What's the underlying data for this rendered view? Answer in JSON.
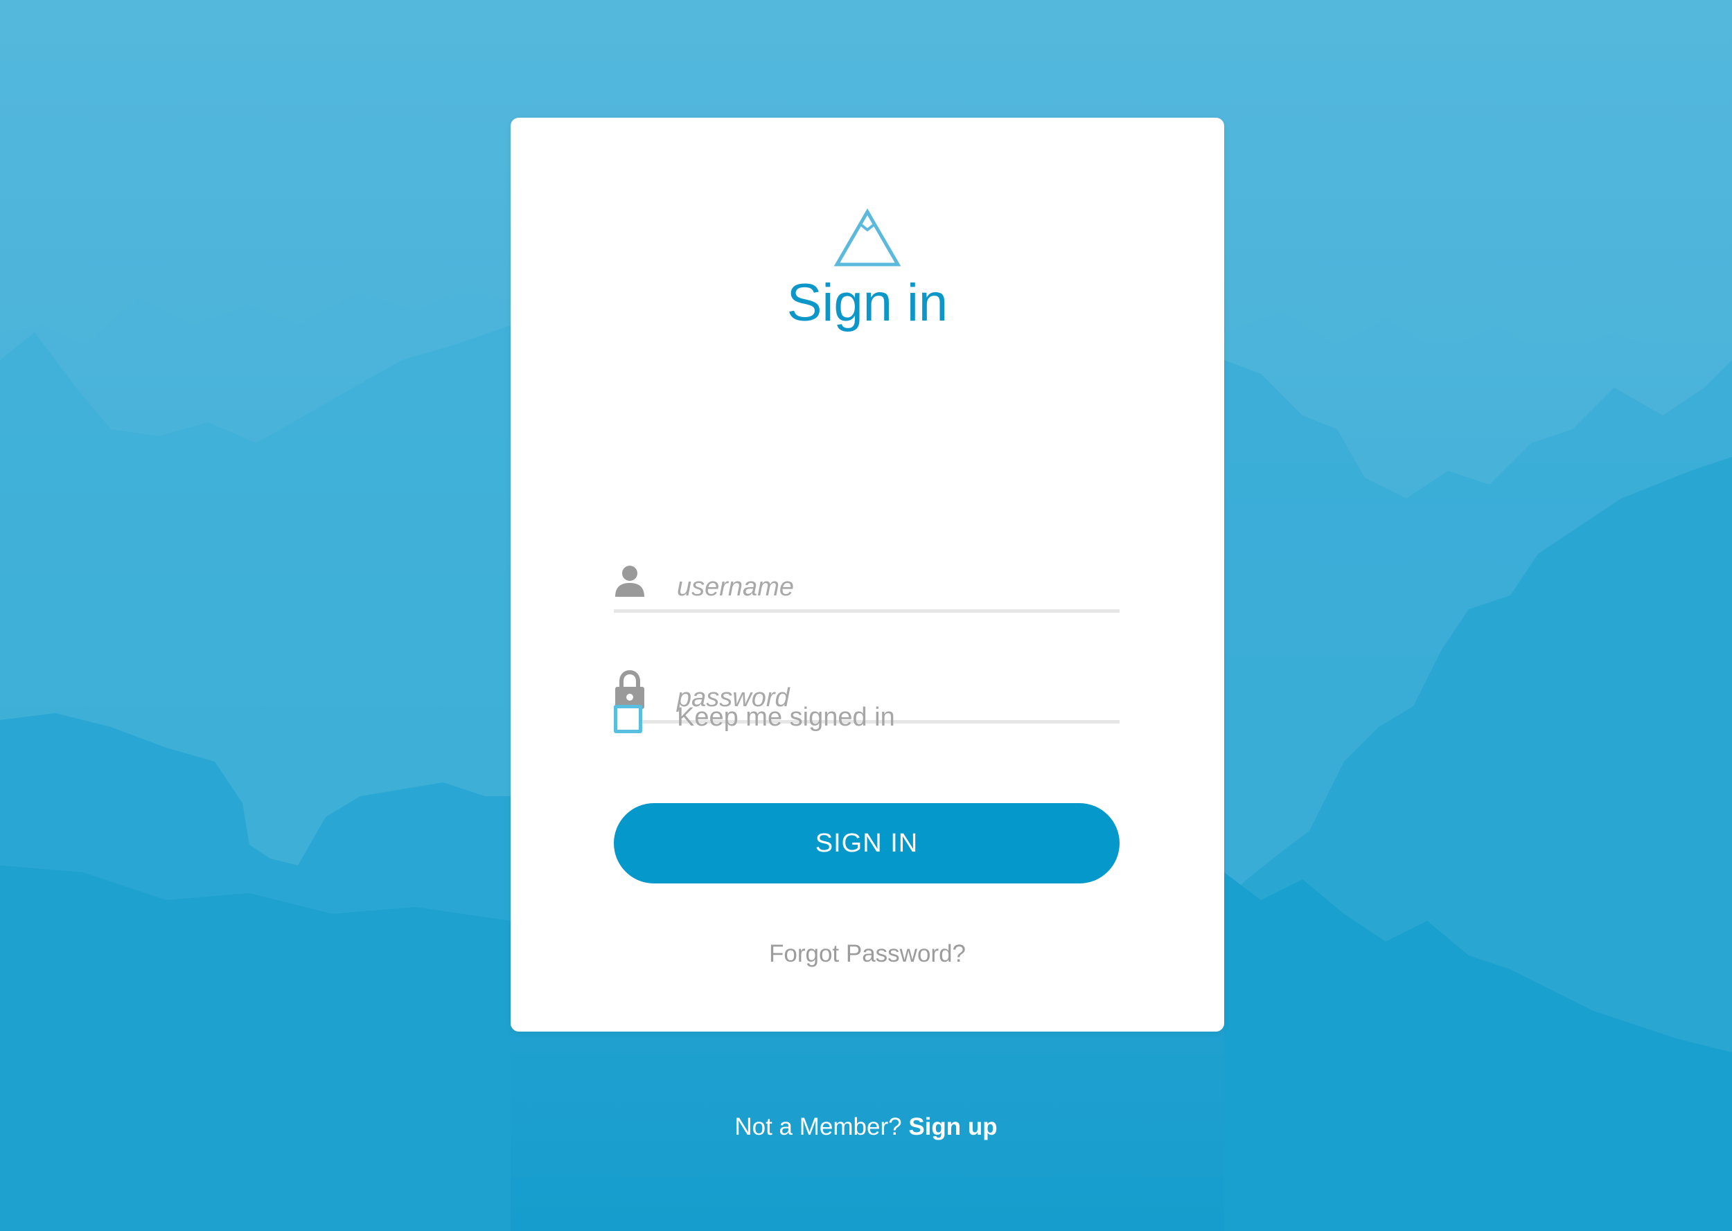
{
  "colors": {
    "accent": "#0598cb",
    "title": "#0d97c9",
    "checkbox_border": "#59bfe0",
    "background_top": "#54b8dc",
    "background_bottom": "#169dcd"
  },
  "logo": {
    "icon": "mountain-triangle-icon"
  },
  "title": "Sign in",
  "form": {
    "username": {
      "icon": "user-icon",
      "placeholder": "username",
      "value": ""
    },
    "password": {
      "icon": "lock-icon",
      "placeholder": "password",
      "value": ""
    },
    "keep_signed_in": {
      "label": "Keep me signed in",
      "checked": false
    },
    "submit_label": "SIGN IN",
    "forgot_label": "Forgot Password?"
  },
  "footer": {
    "prompt": "Not a Member?",
    "signup_label": "Sign up"
  }
}
